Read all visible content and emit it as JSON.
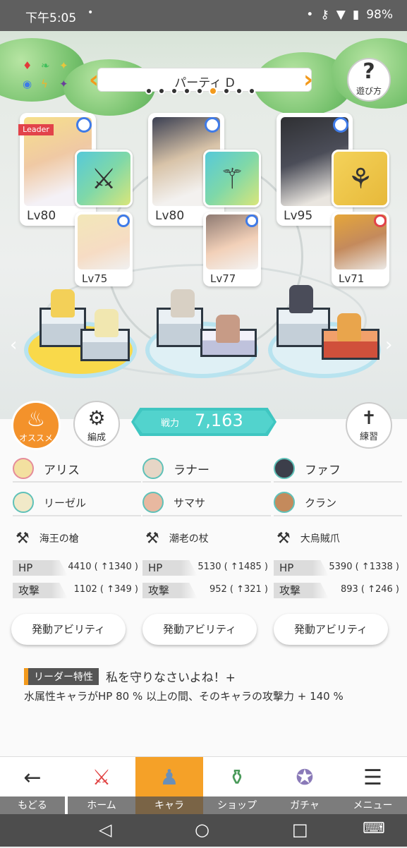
{
  "status_bar": {
    "time": "下午5:05",
    "dot": "•",
    "battery": "98%"
  },
  "party": {
    "title": "パーティ D",
    "pages": 9,
    "current_page": 6
  },
  "help": {
    "icon": "?",
    "label": "遊び方"
  },
  "leader_tag": "Leader",
  "main_chars": [
    {
      "level": "Lv80",
      "sub_level": "Lv75"
    },
    {
      "level": "Lv80",
      "sub_level": "Lv77"
    },
    {
      "level": "Lv95",
      "sub_level": "Lv71"
    }
  ],
  "recommend": {
    "label": "オススメ"
  },
  "formation": {
    "label": "編成"
  },
  "power": {
    "label": "戦力",
    "value": "7,163"
  },
  "practice": {
    "label": "練習"
  },
  "columns": [
    {
      "main": "アリス",
      "sub": "リーゼル",
      "weapon": "海王の槍",
      "hp_label": "HP",
      "hp": "4410 ( ↑1340 )",
      "atk_label": "攻撃",
      "atk": "1102 ( ↑349 )",
      "ability": "発動アビリティ"
    },
    {
      "main": "ラナー",
      "sub": "サマサ",
      "weapon": "潮老の杖",
      "hp_label": "HP",
      "hp": "5130 ( ↑1485 )",
      "atk_label": "攻撃",
      "atk": "952 ( ↑321 )",
      "ability": "発動アビリティ"
    },
    {
      "main": "ファフ",
      "sub": "クラン",
      "weapon": "大烏賊爪",
      "hp_label": "HP",
      "hp": "5390 ( ↑1338 )",
      "atk_label": "攻撃",
      "atk": "893 ( ↑246 )",
      "ability": "発動アビリティ"
    }
  ],
  "leader": {
    "tag": "リーダー特性",
    "name": "私を守りなさいよね！+",
    "desc": "水属性キャラがHP 80 % 以上の間、そのキャラの攻撃力 + 140 %"
  },
  "nav": {
    "back": "もどる",
    "home": "ホーム",
    "chara": "キャラ",
    "shop": "ショップ",
    "gacha": "ガチャ",
    "menu": "メニュー"
  }
}
